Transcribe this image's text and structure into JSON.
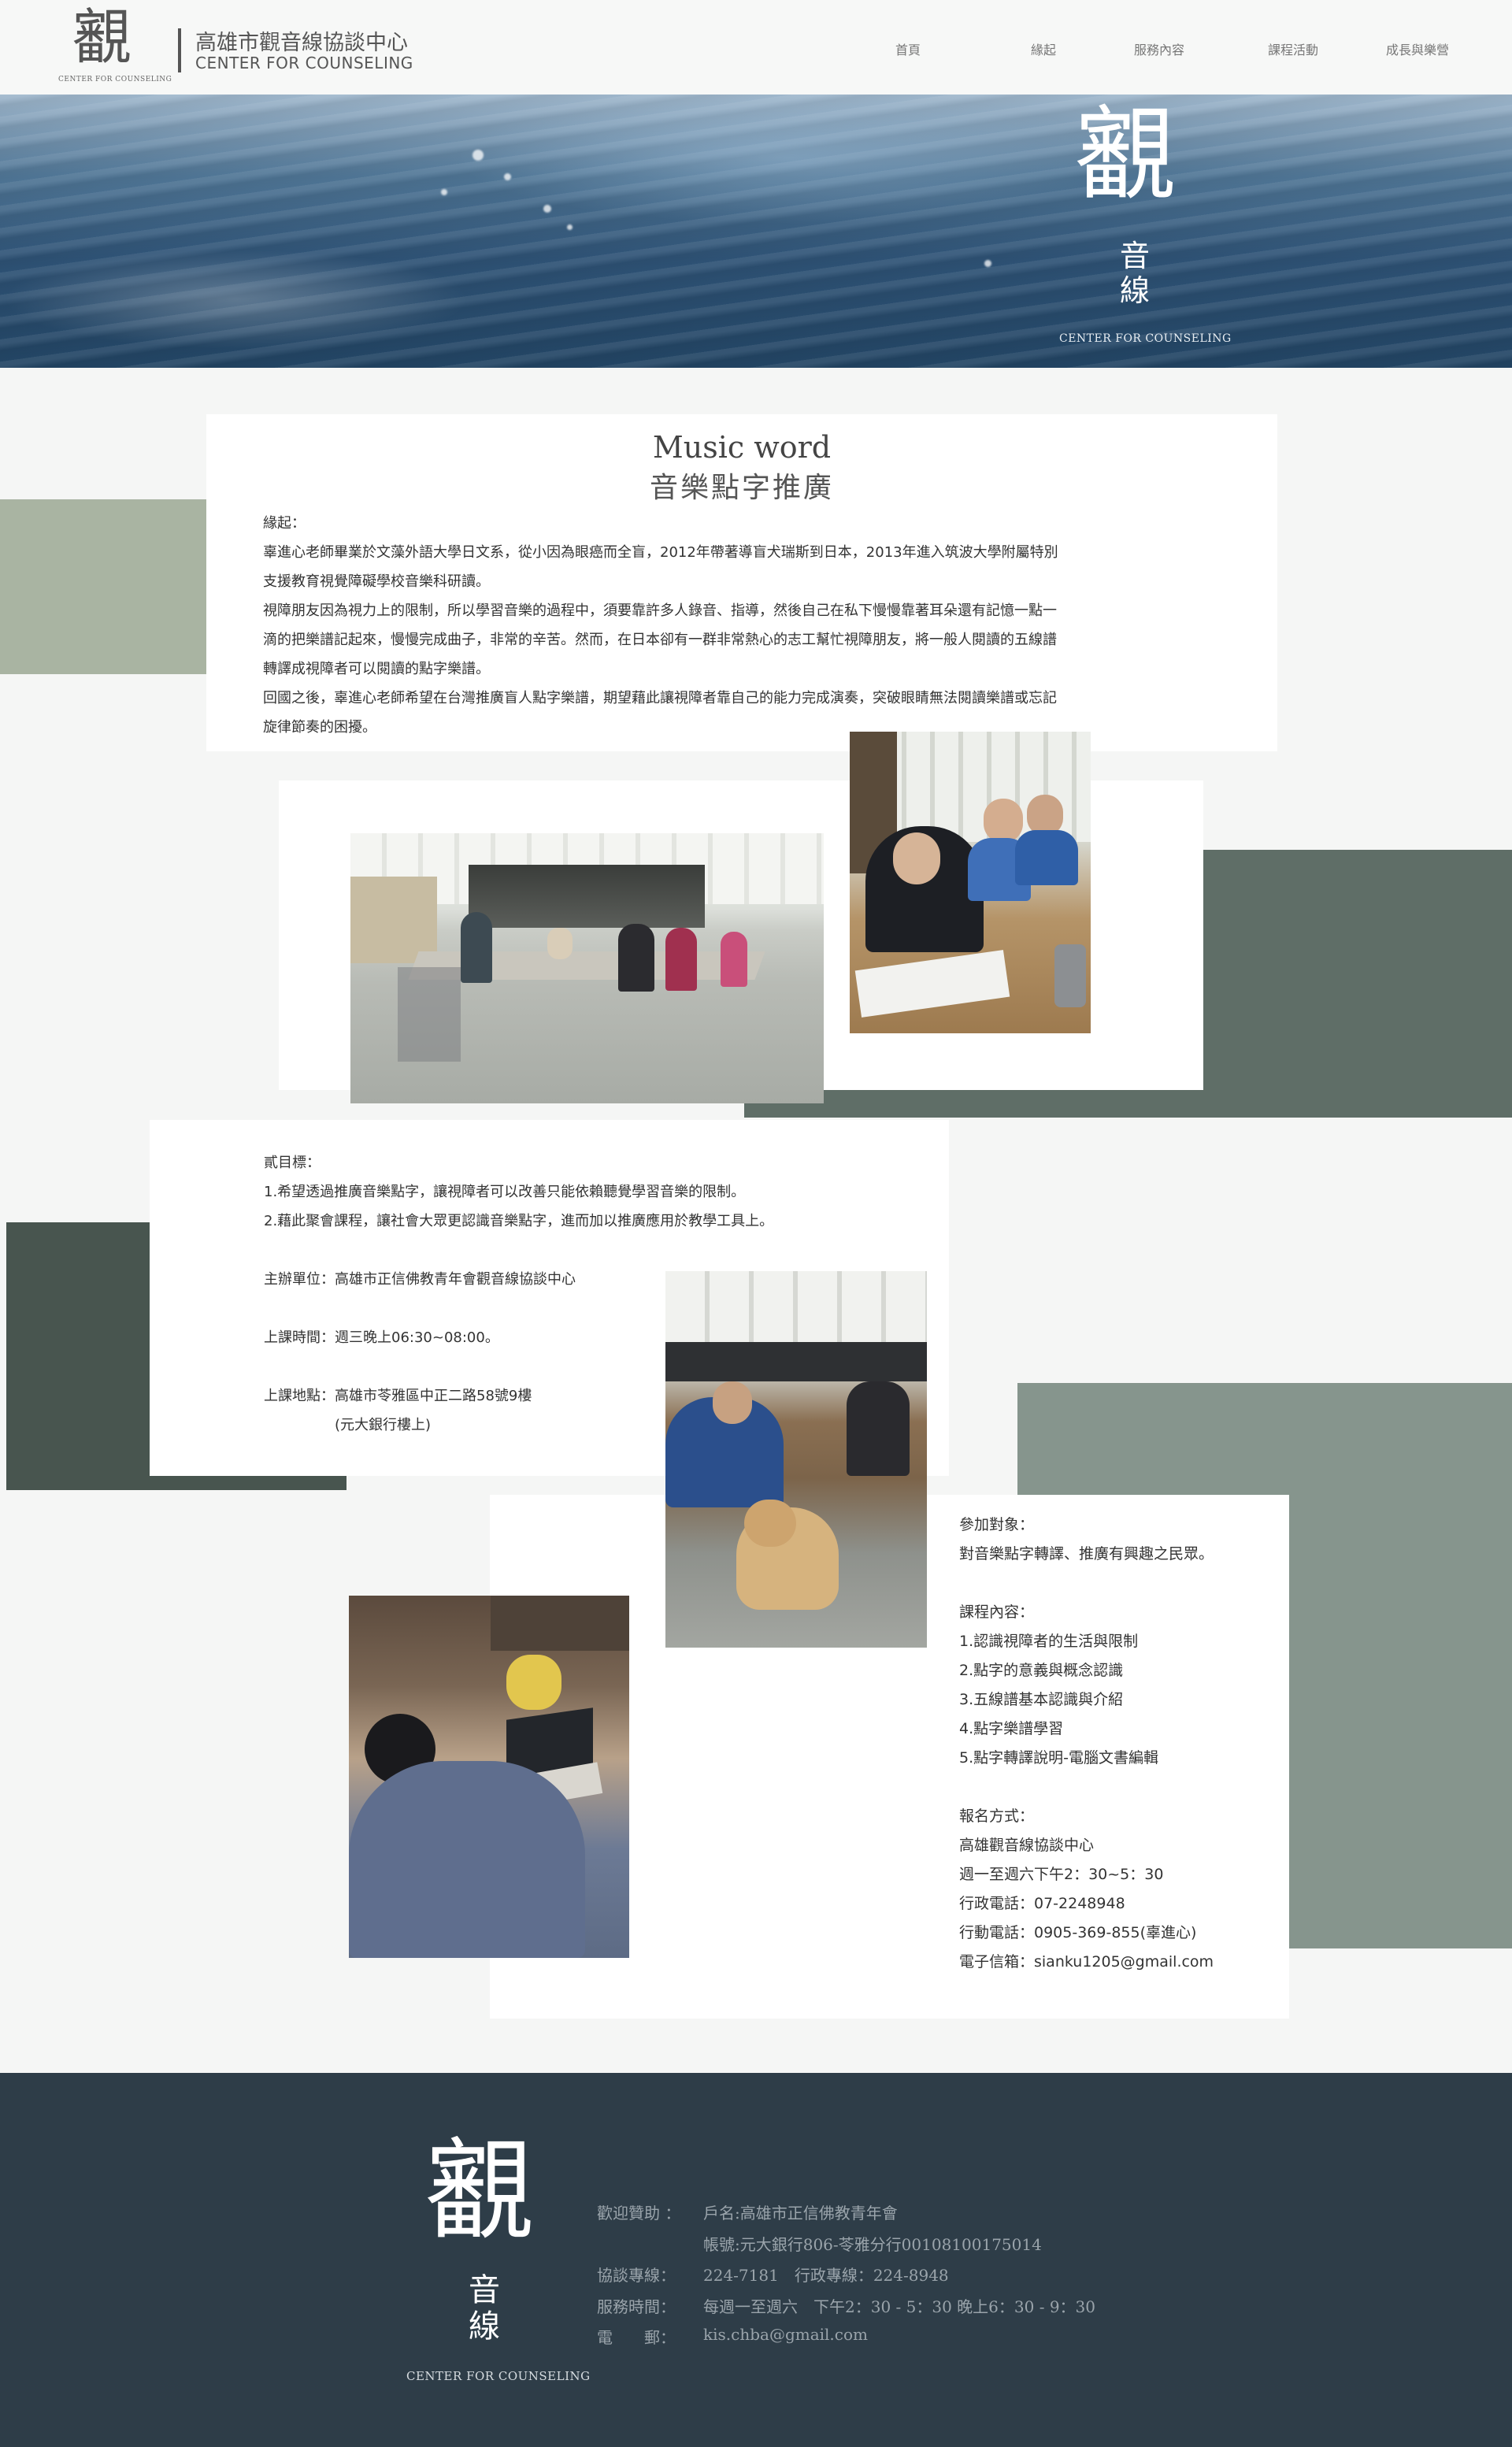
{
  "header": {
    "logo_char": "覾",
    "logo_sub": "CENTER FOR COUNSELING",
    "brand_zh": "高雄市觀音線協談中心",
    "brand_en": "CENTER FOR COUNSELING",
    "nav": [
      "首頁",
      "緣起",
      "服務內容",
      "課程活動",
      "成長與樂營"
    ]
  },
  "hero": {
    "char": "覾",
    "char2": "音",
    "char3": "線",
    "sub": "CENTER FOR COUNSELING"
  },
  "intro": {
    "title_en": "Music word",
    "title_zh": "音樂點字推廣",
    "lines": [
      "緣起：",
      "辜進心老師畢業於文藻外語大學日文系，從小因為眼癌而全盲，2012年帶著導盲犬瑞斯到日本，2013年進入筑波大學附屬特別",
      "支援教育視覺障礙學校音樂科研讀。",
      "視障朋友因為視力上的限制，所以學習音樂的過程中，須要靠許多人錄音、指導，然後自己在私下慢慢靠著耳朵還有記憶一點一",
      "滴的把樂譜記起來，慢慢完成曲子，非常的辛苦。然而，在日本卻有一群非常熱心的志工幫忙視障朋友，將一般人閱讀的五線譜",
      "轉譯成視障者可以閱讀的點字樂譜。",
      "回國之後，辜進心老師希望在台灣推廣盲人點字樂譜，期望藉此讓視障者靠自己的能力完成演奏，突破眼睛無法閱讀樂譜或忘記",
      "旋律節奏的困擾。"
    ]
  },
  "goals": {
    "lines": [
      "貳目標：",
      "1.希望透過推廣音樂點字，讓視障者可以改善只能依賴聽覺學習音樂的限制。",
      "2.藉此聚會課程，讓社會大眾更認識音樂點字，進而加以推廣應用於教學工具上。",
      "",
      "主辦單位：高雄市正信佛教青年會觀音線協談中心",
      "",
      "上課時間：週三晚上06:30~08:00。",
      "",
      "上課地點：高雄市苓雅區中正二路58號9樓",
      "　　　　　(元大銀行樓上)"
    ]
  },
  "details": {
    "lines": [
      "參加對象：",
      "對音樂點字轉譯、推廣有興趣之民眾。",
      "",
      "課程內容：",
      "1.認識視障者的生活與限制",
      "2.點字的意義與概念認識",
      "3.五線譜基本認識與介紹",
      "4.點字樂譜學習",
      "5.點字轉譯說明-電腦文書編輯",
      "",
      "報名方式：",
      "高雄觀音線協談中心",
      "週一至週六下午2：30~5：30",
      "行政電話：07-2248948",
      "行動電話：0905-369-855(辜進心)",
      "電子信箱：sianku1205@gmail.com"
    ]
  },
  "footer": {
    "char": "覾",
    "char2": "音",
    "char3": "線",
    "sub": "CENTER FOR COUNSELING",
    "rows": [
      {
        "label": "歡迎贊助 ：",
        "value": "戶名:高雄市正信佛教青年會"
      },
      {
        "label": "",
        "value": "帳號:元大銀行806-苓雅分行00108100175014"
      },
      {
        "label": "協談專線：",
        "value": "224-7181　行政專線：224-8948"
      },
      {
        "label": "服務時間：",
        "value": "每週一至週六　下午2：30 - 5：30 晚上6：30 - 9：30"
      },
      {
        "label": "電　　郵：",
        "value": "kis.chba@gmail.com"
      }
    ]
  },
  "colors": {
    "sage": "#a9b4a2",
    "slate_green": "#5f6e67",
    "dark_slate": "#48554f",
    "gray_green": "#86958d",
    "footer_bg": "#2e3d48"
  }
}
